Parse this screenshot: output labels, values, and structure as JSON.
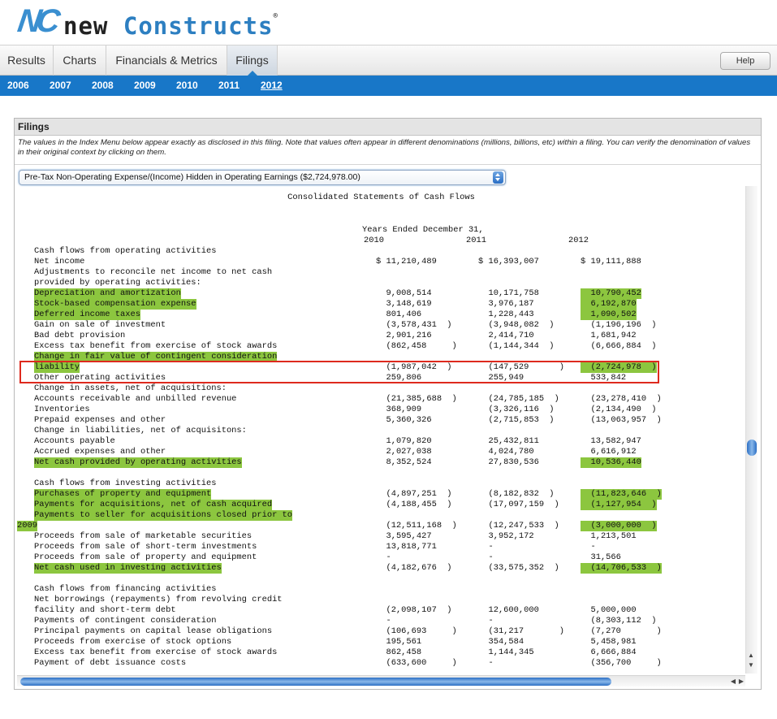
{
  "header": {
    "logo_mark": "NC",
    "brand_word1": "new",
    "brand_word2": "Constructs",
    "brand_reg": "®",
    "help_label": "Help"
  },
  "tabs": [
    {
      "label": "Results",
      "active": false
    },
    {
      "label": "Charts",
      "active": false
    },
    {
      "label": "Financials & Metrics",
      "active": false
    },
    {
      "label": "Filings",
      "active": true
    }
  ],
  "years": [
    {
      "label": "2006",
      "active": false
    },
    {
      "label": "2007",
      "active": false
    },
    {
      "label": "2008",
      "active": false
    },
    {
      "label": "2009",
      "active": false
    },
    {
      "label": "2010",
      "active": false
    },
    {
      "label": "2011",
      "active": false
    },
    {
      "label": "2012",
      "active": true
    }
  ],
  "panel": {
    "title": "Filings",
    "description": "The values in the Index Menu below appear exactly as disclosed in this filing. Note that values often appear in different denominations (millions, billions, etc) within a filing. You can verify the denomination of values in their original context by clicking on them.",
    "select_value": "Pre-Tax Non-Operating Expense/(Income) Hidden in Operating Earnings ($2,724,978.00)"
  },
  "document": {
    "title": "Consolidated Statements of Cash Flows",
    "period_header": "Years Ended December 31,",
    "years": [
      "2010",
      "2011",
      "2012"
    ],
    "rows": [
      {
        "label": "Cash flows from operating activities",
        "v": [
          "",
          "",
          ""
        ],
        "hl": [
          false,
          false,
          false,
          false
        ]
      },
      {
        "label": "Net income",
        "v": [
          "$ 11,210,489",
          "$ 16,393,007",
          "$ 19,111,888"
        ],
        "hl": [
          false,
          false,
          false,
          false
        ]
      },
      {
        "label": "Adjustments to reconcile net income to net cash",
        "v": [
          "",
          "",
          ""
        ],
        "hl": [
          false,
          false,
          false,
          false
        ]
      },
      {
        "label": "provided by operating activities:",
        "v": [
          "",
          "",
          ""
        ],
        "hl": [
          false,
          false,
          false,
          false
        ]
      },
      {
        "label": "Depreciation and amortization",
        "v": [
          "  9,008,514",
          "  10,171,758",
          "  10,790,452"
        ],
        "hl": [
          true,
          false,
          false,
          true
        ]
      },
      {
        "label": "Stock-based compensation expense",
        "v": [
          "  3,148,619",
          "  3,976,187",
          "  6,192,870"
        ],
        "hl": [
          true,
          false,
          false,
          true
        ]
      },
      {
        "label": "Deferred income taxes",
        "v": [
          "  801,406",
          "  1,228,443",
          "  1,090,502"
        ],
        "hl": [
          true,
          false,
          false,
          true
        ]
      },
      {
        "label": "Gain on sale of investment",
        "v": [
          "  (3,578,431  )",
          "  (3,948,082  )",
          "  (1,196,196  )"
        ],
        "hl": [
          false,
          false,
          false,
          false
        ]
      },
      {
        "label": "Bad debt provision",
        "v": [
          "  2,901,216",
          "  2,414,710",
          "  1,681,942"
        ],
        "hl": [
          false,
          false,
          false,
          false
        ]
      },
      {
        "label": "Excess tax benefit from exercise of stock awards",
        "v": [
          "  (862,458     )",
          "  (1,144,344  )",
          "  (6,666,884  )"
        ],
        "hl": [
          false,
          false,
          false,
          false
        ]
      },
      {
        "label": "Change in fair value of contingent consideration",
        "v": [
          "",
          "",
          ""
        ],
        "hl": [
          true,
          false,
          false,
          false
        ]
      },
      {
        "label": "liability",
        "v": [
          "  (1,987,042  )",
          "  (147,529      )",
          "  (2,724,978  )"
        ],
        "hl": [
          true,
          false,
          false,
          true
        ]
      },
      {
        "label": "Other operating activities",
        "v": [
          "  259,806",
          "  255,949",
          "  533,842"
        ],
        "hl": [
          false,
          false,
          false,
          false
        ]
      },
      {
        "label": "Change in assets, net of acquisitions:",
        "v": [
          "",
          "",
          ""
        ],
        "hl": [
          false,
          false,
          false,
          false
        ]
      },
      {
        "label": "Accounts receivable and unbilled revenue",
        "v": [
          "  (21,385,688  )",
          "  (24,785,185  )",
          "  (23,278,410  )"
        ],
        "hl": [
          false,
          false,
          false,
          false
        ]
      },
      {
        "label": "Inventories",
        "v": [
          "  368,909",
          "  (3,326,116  )",
          "  (2,134,490  )"
        ],
        "hl": [
          false,
          false,
          false,
          false
        ]
      },
      {
        "label": "Prepaid expenses and other",
        "v": [
          "  5,360,326",
          "  (2,715,853  )",
          "  (13,063,957  )"
        ],
        "hl": [
          false,
          false,
          false,
          false
        ]
      },
      {
        "label": "Change in liabilities, net of acquisitons:",
        "v": [
          "",
          "",
          ""
        ],
        "hl": [
          false,
          false,
          false,
          false
        ]
      },
      {
        "label": "Accounts payable",
        "v": [
          "  1,079,820",
          "  25,432,811",
          "  13,582,947"
        ],
        "hl": [
          false,
          false,
          false,
          false
        ]
      },
      {
        "label": "Accrued expenses and other",
        "v": [
          "  2,027,038",
          "  4,024,780",
          "  6,616,912"
        ],
        "hl": [
          false,
          false,
          false,
          false
        ]
      },
      {
        "label": "Net cash provided by operating activities",
        "v": [
          "  8,352,524",
          "  27,830,536",
          "  10,536,440"
        ],
        "hl": [
          true,
          false,
          false,
          true
        ]
      },
      {
        "label": "",
        "v": [
          "",
          "",
          ""
        ],
        "hl": [
          false,
          false,
          false,
          false
        ]
      },
      {
        "label": "Cash flows from investing activities",
        "v": [
          "",
          "",
          ""
        ],
        "hl": [
          false,
          false,
          false,
          false
        ]
      },
      {
        "label": "Purchases of property and equipment",
        "v": [
          "  (4,897,251  )",
          "  (8,182,832  )",
          "  (11,823,646  )"
        ],
        "hl": [
          true,
          false,
          false,
          true
        ]
      },
      {
        "label": "Payments for acquisitions, net of cash acquired",
        "v": [
          "  (4,188,455  )",
          "  (17,097,159  )",
          "  (1,127,954  )"
        ],
        "hl": [
          true,
          false,
          false,
          true
        ]
      },
      {
        "label": "Payments to seller for acquisitions closed prior to",
        "v": [
          "",
          "",
          ""
        ],
        "hl": [
          true,
          false,
          false,
          false
        ]
      },
      {
        "label": "2009",
        "v": [
          "  (12,511,168  )",
          "  (12,247,533  )",
          "  (3,000,000  )"
        ],
        "hl": [
          true,
          false,
          false,
          true
        ],
        "outdent": true
      },
      {
        "label": "Proceeds from sale of marketable securities",
        "v": [
          "  3,595,427",
          "  3,952,172",
          "  1,213,501"
        ],
        "hl": [
          false,
          false,
          false,
          false
        ]
      },
      {
        "label": "Proceeds from sale of short-term investments",
        "v": [
          "  13,818,771",
          "  -",
          "  -"
        ],
        "hl": [
          false,
          false,
          false,
          false
        ]
      },
      {
        "label": "Proceeds from sale of property and equipment",
        "v": [
          "  -",
          "  -",
          "  31,566"
        ],
        "hl": [
          false,
          false,
          false,
          false
        ]
      },
      {
        "label": "Net cash used in investing activities",
        "v": [
          "  (4,182,676  )",
          "  (33,575,352  )",
          "  (14,706,533  )"
        ],
        "hl": [
          true,
          false,
          false,
          true
        ]
      },
      {
        "label": "",
        "v": [
          "",
          "",
          ""
        ],
        "hl": [
          false,
          false,
          false,
          false
        ]
      },
      {
        "label": "Cash flows from financing activities",
        "v": [
          "",
          "",
          ""
        ],
        "hl": [
          false,
          false,
          false,
          false
        ]
      },
      {
        "label": "Net borrowings (repayments) from revolving credit",
        "v": [
          "",
          "",
          ""
        ],
        "hl": [
          false,
          false,
          false,
          false
        ]
      },
      {
        "label": "facility and short-term debt",
        "v": [
          "  (2,098,107  )",
          "  12,600,000",
          "  5,000,000"
        ],
        "hl": [
          false,
          false,
          false,
          false
        ]
      },
      {
        "label": "Payments of contingent consideration",
        "v": [
          "  -",
          "  -",
          "  (8,303,112  )"
        ],
        "hl": [
          false,
          false,
          false,
          false
        ]
      },
      {
        "label": "Principal payments on capital lease obligations",
        "v": [
          "  (106,693     )",
          "  (31,217       )",
          "  (7,270       )"
        ],
        "hl": [
          false,
          false,
          false,
          false
        ]
      },
      {
        "label": "Proceeds from exercise of stock options",
        "v": [
          "  195,561",
          "  354,584",
          "  5,458,981"
        ],
        "hl": [
          false,
          false,
          false,
          false
        ]
      },
      {
        "label": "Excess tax benefit from exercise of stock awards",
        "v": [
          "  862,458",
          "  1,144,345",
          "  6,666,884"
        ],
        "hl": [
          false,
          false,
          false,
          false
        ]
      },
      {
        "label": "Payment of debt issuance costs",
        "v": [
          "  (633,600     )",
          "  -",
          "  (356,700     )"
        ],
        "hl": [
          false,
          false,
          false,
          false
        ]
      }
    ]
  },
  "scroll": {
    "up_glyph": "▲",
    "down_glyph": "▼",
    "left_glyph": "◀",
    "right_glyph": "▶"
  }
}
